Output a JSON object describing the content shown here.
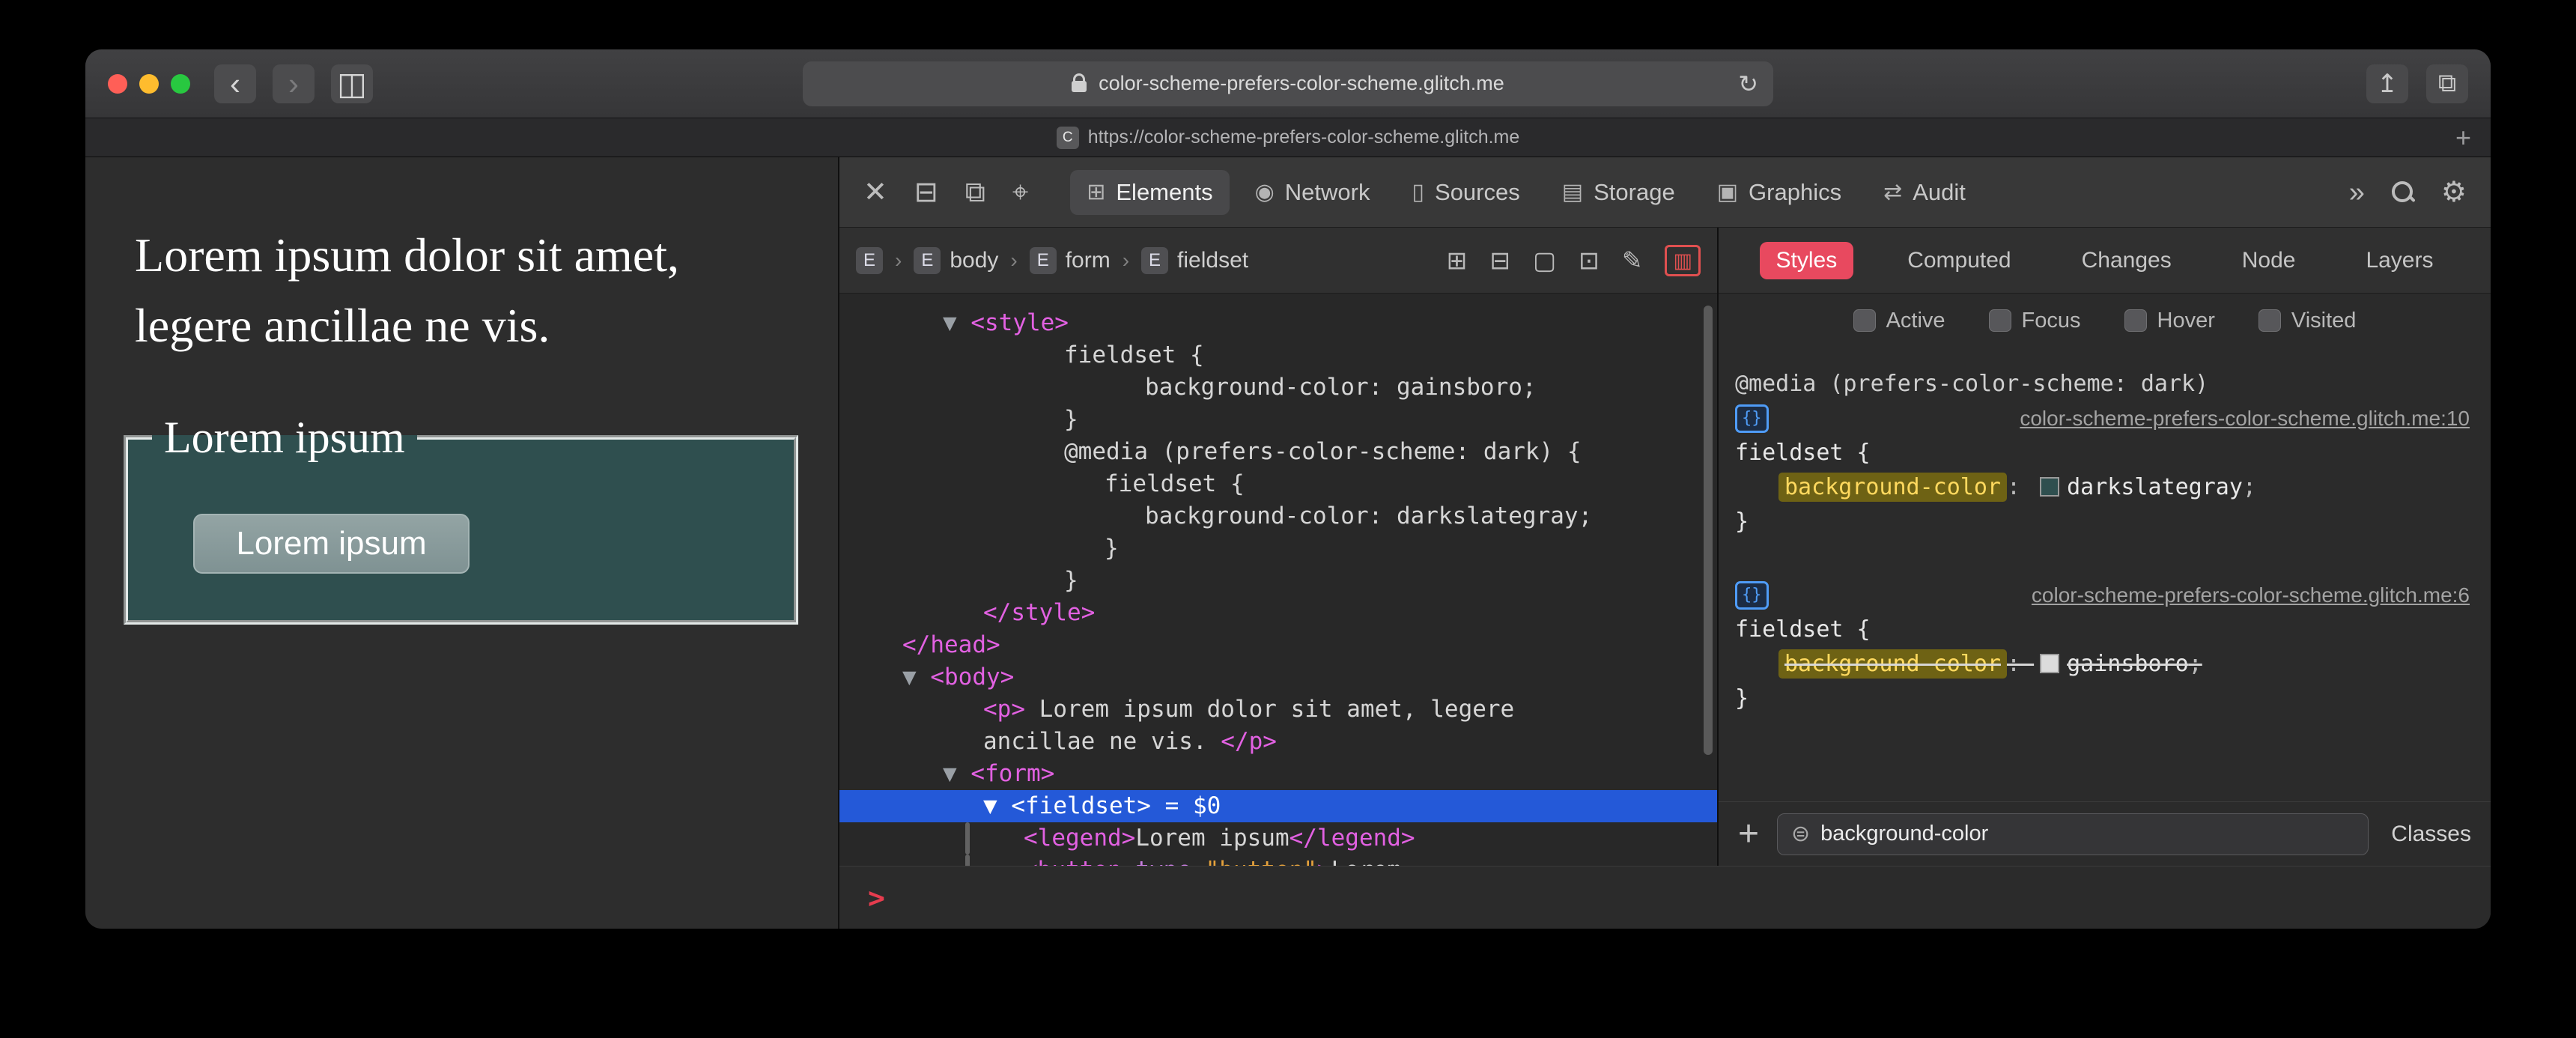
{
  "colors": {
    "selection_blue": "#2459d8",
    "styles_tab_red": "#e8495f",
    "traffic_red": "#ff5f57",
    "traffic_yellow": "#febc2e",
    "traffic_green": "#28c840",
    "prompt_red": "#e63c4e"
  },
  "titlebar": {
    "back_icon": "‹",
    "forward_icon": "›",
    "sidebar_icon": "◫",
    "address": "color-scheme-prefers-color-scheme.glitch.me",
    "reload_icon": "↻",
    "share_icon": "↥",
    "tab_overview_icon": "⧉"
  },
  "tabbar": {
    "favicon_letter": "C",
    "tab_title": "https://color-scheme-prefers-color-scheme.glitch.me",
    "new_tab": "+"
  },
  "page": {
    "paragraph": [
      "Lorem ipsum dolor sit amet,",
      "legere ancillae ne vis."
    ],
    "legend": "Lorem ipsum",
    "button": "Lorem ipsum"
  },
  "devtools": {
    "toolbar": {
      "close_icon": "✕",
      "dock_bottom_icon": "⊟",
      "dock_side_icon": "⧉",
      "target_icon": "⌖",
      "tabs": [
        {
          "icon": "⊞",
          "label": "Elements",
          "selected": true
        },
        {
          "icon": "◉",
          "label": "Network",
          "selected": false
        },
        {
          "icon": "▯",
          "label": "Sources",
          "selected": false
        },
        {
          "icon": "▤",
          "label": "Storage",
          "selected": false
        },
        {
          "icon": "▣",
          "label": "Graphics",
          "selected": false
        },
        {
          "icon": "⇄",
          "label": "Audit",
          "selected": false
        }
      ],
      "more_icon": "»",
      "gear_icon": "⚙"
    },
    "breadcrumb": {
      "separator": "›",
      "items": [
        {
          "badge": "E",
          "label": ""
        },
        {
          "badge": "E",
          "label": "body"
        },
        {
          "badge": "E",
          "label": "form"
        },
        {
          "badge": "E",
          "label": "fieldset"
        }
      ],
      "action_icons": [
        "⊞",
        "⊟",
        "▢",
        "⊡",
        "✎"
      ],
      "badges_toggle_icon": "▥"
    },
    "panel_tabs": [
      {
        "label": "Styles",
        "selected": true
      },
      {
        "label": "Computed",
        "selected": false
      },
      {
        "label": "Changes",
        "selected": false
      },
      {
        "label": "Node",
        "selected": false
      },
      {
        "label": "Layers",
        "selected": false
      }
    ],
    "pseudo_toggles": [
      "Active",
      "Focus",
      "Hover",
      "Visited"
    ],
    "dom_lines": [
      {
        "indent": 1,
        "segs": [
          [
            "arrow",
            "▼ "
          ],
          [
            "tag",
            "<style>"
          ]
        ]
      },
      {
        "indent": 4,
        "segs": [
          [
            "plain",
            "fieldset {"
          ]
        ]
      },
      {
        "indent": 6,
        "segs": [
          [
            "plain",
            "background-color: gainsboro;"
          ]
        ]
      },
      {
        "indent": 4,
        "segs": [
          [
            "plain",
            "}"
          ]
        ]
      },
      {
        "indent": 4,
        "segs": [
          [
            "plain",
            "@media (prefers-color-scheme: dark) {"
          ]
        ]
      },
      {
        "indent": 5,
        "segs": [
          [
            "plain",
            "fieldset {"
          ]
        ]
      },
      {
        "indent": 6,
        "segs": [
          [
            "plain",
            "background-color: darkslategray;"
          ]
        ]
      },
      {
        "indent": 5,
        "segs": [
          [
            "plain",
            "}"
          ]
        ]
      },
      {
        "indent": 4,
        "segs": [
          [
            "plain",
            "}"
          ]
        ]
      },
      {
        "indent": 2,
        "segs": [
          [
            "tag",
            "</style>"
          ]
        ]
      },
      {
        "indent": 0,
        "segs": [
          [
            "tag",
            "</head>"
          ]
        ]
      },
      {
        "indent": 0,
        "segs": [
          [
            "arrow",
            "▼ "
          ],
          [
            "tag",
            "<body>"
          ]
        ]
      },
      {
        "indent": 2,
        "segs": [
          [
            "tag",
            "<p>"
          ],
          [
            "plain",
            " Lorem ipsum dolor sit amet, legere"
          ]
        ]
      },
      {
        "indent": 2,
        "segs": [
          [
            "plain",
            "ancillae ne vis. "
          ],
          [
            "tag",
            "</p>"
          ]
        ]
      },
      {
        "indent": 1,
        "segs": [
          [
            "arrow",
            "▼ "
          ],
          [
            "tag",
            "<form>"
          ]
        ]
      },
      {
        "indent": 2,
        "selected": true,
        "segs": [
          [
            "arrow",
            "▼ "
          ],
          [
            "tag",
            "<fieldset>"
          ],
          [
            "plain",
            " = $0"
          ]
        ]
      },
      {
        "indent": 3,
        "guide": true,
        "segs": [
          [
            "tag",
            "<legend>"
          ],
          [
            "plain",
            "Lorem ipsum"
          ],
          [
            "tag",
            "</legend>"
          ]
        ]
      },
      {
        "indent": 3,
        "guide": true,
        "segs": [
          [
            "tag",
            "<button "
          ],
          [
            "attr",
            "type"
          ],
          [
            "plain",
            "="
          ],
          [
            "val",
            "\"button\""
          ],
          [
            "tag",
            ">"
          ],
          [
            "plain",
            "Lorem"
          ]
        ]
      }
    ],
    "styles_panel": {
      "media_query": "@media (prefers-color-scheme: dark)",
      "brace_icon": "{}",
      "colon": ": ",
      "semicolon": ";",
      "rules": [
        {
          "link": "color-scheme-prefers-color-scheme.glitch.me:10",
          "selector": "fieldset {",
          "property": "background-color",
          "value": "darkslategray",
          "swatch": "#2f4f4f",
          "overridden": false,
          "close": "}"
        },
        {
          "link": "color-scheme-prefers-color-scheme.glitch.me:6",
          "selector": "fieldset {",
          "property": "background-color",
          "value": "gainsboro",
          "swatch": "#dcdcdc",
          "overridden": true,
          "close": "}"
        }
      ],
      "add_button": "+",
      "filter_icon": "⊜",
      "filter_value": "background-color",
      "classes_label": "Classes"
    },
    "console_prompt": ">"
  }
}
